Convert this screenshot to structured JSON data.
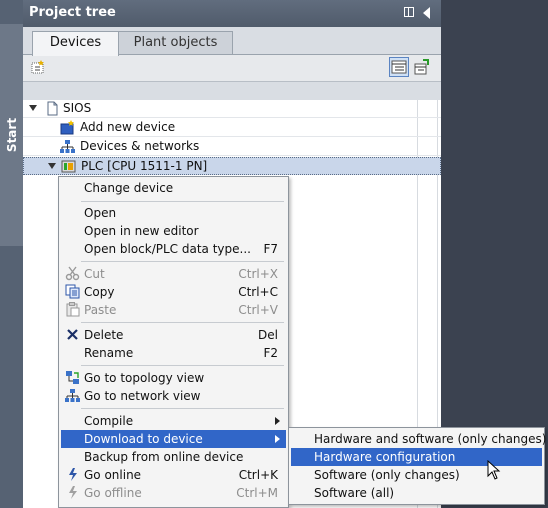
{
  "sidebar_strip": {
    "label": "Start"
  },
  "panel": {
    "title": "Project tree",
    "tabs": [
      {
        "label": "Devices",
        "active": true
      },
      {
        "label": "Plant objects",
        "active": false
      }
    ]
  },
  "tree": {
    "items": [
      {
        "label": "SIOS",
        "icon": "project-icon",
        "expanded": true
      },
      {
        "label": "Add new device",
        "icon": "add-device-icon"
      },
      {
        "label": "Devices & networks",
        "icon": "network-icon"
      },
      {
        "label": "PLC [CPU 1511-1 PN]",
        "icon": "plc-icon",
        "expanded": true,
        "selected": true
      }
    ]
  },
  "context_menu": {
    "items": [
      {
        "label": "Change device",
        "shortcut": "",
        "icon": "",
        "disabled": false
      },
      {
        "label": "Open",
        "shortcut": "",
        "icon": "",
        "disabled": false
      },
      {
        "label": "Open in new editor",
        "shortcut": "",
        "icon": "",
        "disabled": false
      },
      {
        "label": "Open block/PLC data type...",
        "shortcut": "F7",
        "icon": "",
        "disabled": false
      },
      {
        "label": "Cut",
        "shortcut": "Ctrl+X",
        "icon": "scissors-icon",
        "disabled": true
      },
      {
        "label": "Copy",
        "shortcut": "Ctrl+C",
        "icon": "copy-icon",
        "disabled": false
      },
      {
        "label": "Paste",
        "shortcut": "Ctrl+V",
        "icon": "paste-icon",
        "disabled": true
      },
      {
        "label": "Delete",
        "shortcut": "Del",
        "icon": "delete-x-icon",
        "disabled": false
      },
      {
        "label": "Rename",
        "shortcut": "F2",
        "icon": "",
        "disabled": false
      },
      {
        "label": "Go to topology view",
        "shortcut": "",
        "icon": "topology-icon",
        "disabled": false
      },
      {
        "label": "Go to network view",
        "shortcut": "",
        "icon": "network-icon",
        "disabled": false
      },
      {
        "label": "Compile",
        "shortcut": "",
        "icon": "",
        "disabled": false,
        "submenu": true
      },
      {
        "label": "Download to device",
        "shortcut": "",
        "icon": "",
        "disabled": false,
        "submenu": true,
        "highlighted": true
      },
      {
        "label": "Backup from online device",
        "shortcut": "",
        "icon": "",
        "disabled": false
      },
      {
        "label": "Go online",
        "shortcut": "Ctrl+K",
        "icon": "go-online-icon",
        "disabled": false
      },
      {
        "label": "Go offline",
        "shortcut": "Ctrl+M",
        "icon": "go-offline-icon",
        "disabled": true
      }
    ]
  },
  "submenu": {
    "items": [
      {
        "label": "Hardware and software (only changes)"
      },
      {
        "label": "Hardware configuration",
        "highlighted": true
      },
      {
        "label": "Software (only changes)"
      },
      {
        "label": "Software (all)"
      }
    ]
  },
  "colors": {
    "header_bg": "#5a6678",
    "highlight": "#3166c8",
    "selection_bg": "#c9d6ea",
    "workspace_bg": "#3b4250"
  }
}
